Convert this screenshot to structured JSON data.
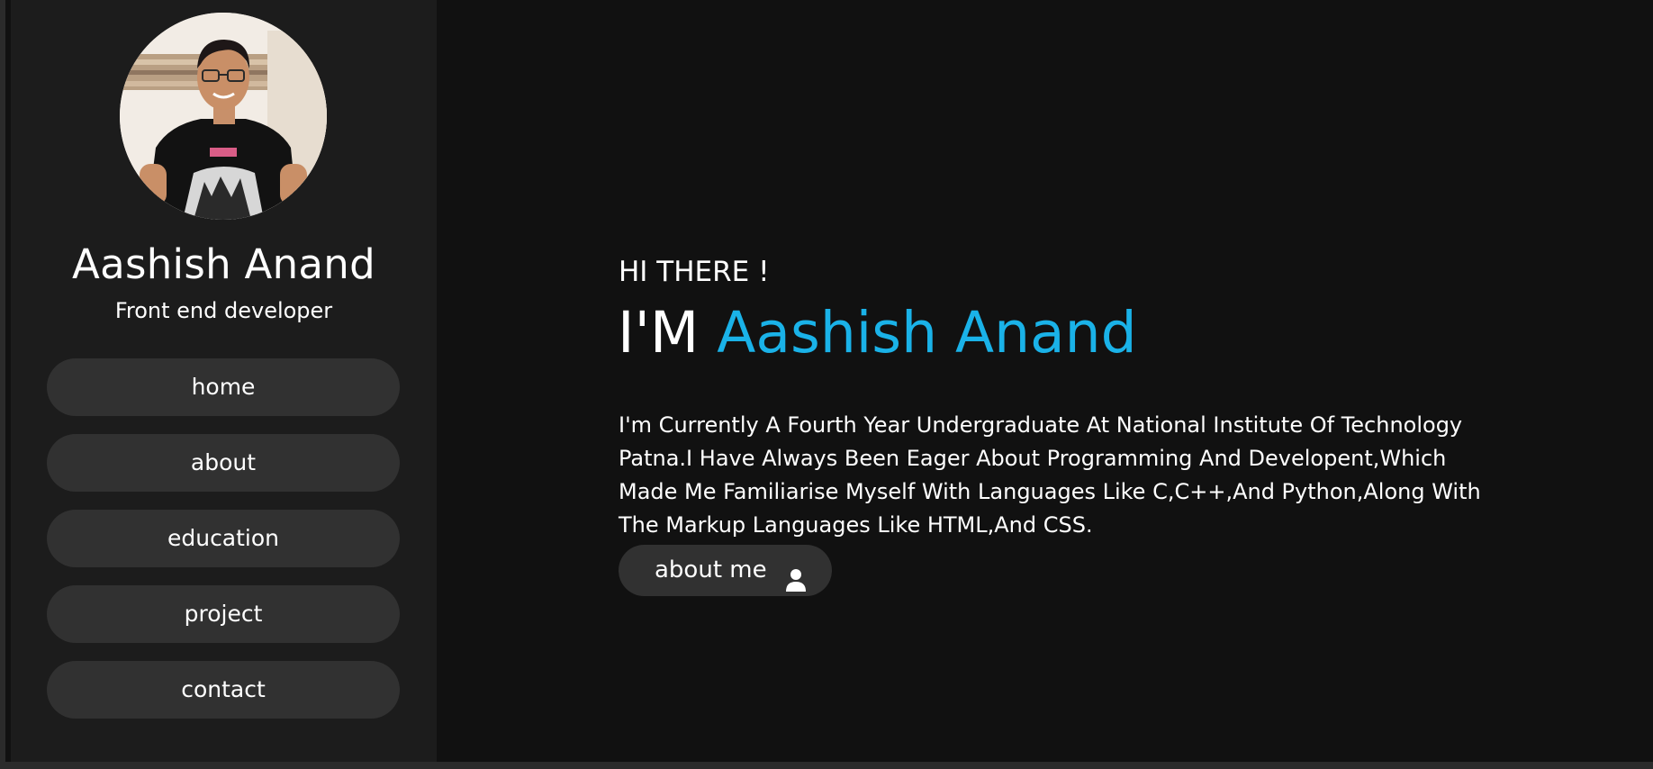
{
  "profile": {
    "name": "Aashish Anand",
    "role": "Front end developer"
  },
  "nav": {
    "items": [
      {
        "label": "home"
      },
      {
        "label": "about"
      },
      {
        "label": "education"
      },
      {
        "label": "project"
      },
      {
        "label": "contact"
      }
    ]
  },
  "hero": {
    "greeting": "HI THERE !",
    "title_prefix": "I'M",
    "title_name": "Aashish Anand",
    "bio": "I'm Currently A Fourth Year Undergraduate At National Institute Of Technology Patna.I Have Always Been Eager About Programming And Developent,Which Made Me Familiarise Myself With Languages Like C,C++,And Python,Along With The Markup Languages Like HTML,And CSS.",
    "button_label": "about me",
    "button_icon": "user-icon"
  },
  "colors": {
    "background": "#111111",
    "sidebar": "#1c1c1c",
    "pill": "#313131",
    "accent": "#1ab2e8",
    "text": "#ffffff"
  }
}
